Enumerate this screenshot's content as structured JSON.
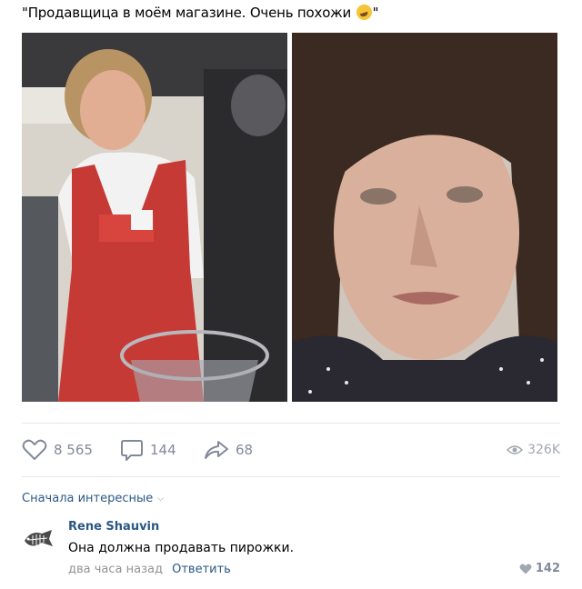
{
  "post": {
    "text": "\"Продавщица в моём магазине. Очень похожи",
    "text_end": "\"",
    "emoji": "rolling-on-floor-laughing-emoji"
  },
  "photos": [
    {
      "name": "photo-saleswoman",
      "alt": ""
    },
    {
      "name": "photo-man-portrait",
      "alt": ""
    }
  ],
  "actions": {
    "likes": "8 565",
    "comments": "144",
    "shares": "68",
    "views": "326K"
  },
  "comments_section": {
    "sort_label": "Сначала интересные"
  },
  "comment": {
    "author": "Rene Shauvin",
    "text": "Она должна продавать пирожки.",
    "time": "два часа назад",
    "reply_label": "Ответить",
    "likes": "142"
  },
  "colors": {
    "link": "#2a5885",
    "muted": "#828a99",
    "divider": "#e7e8ec"
  }
}
